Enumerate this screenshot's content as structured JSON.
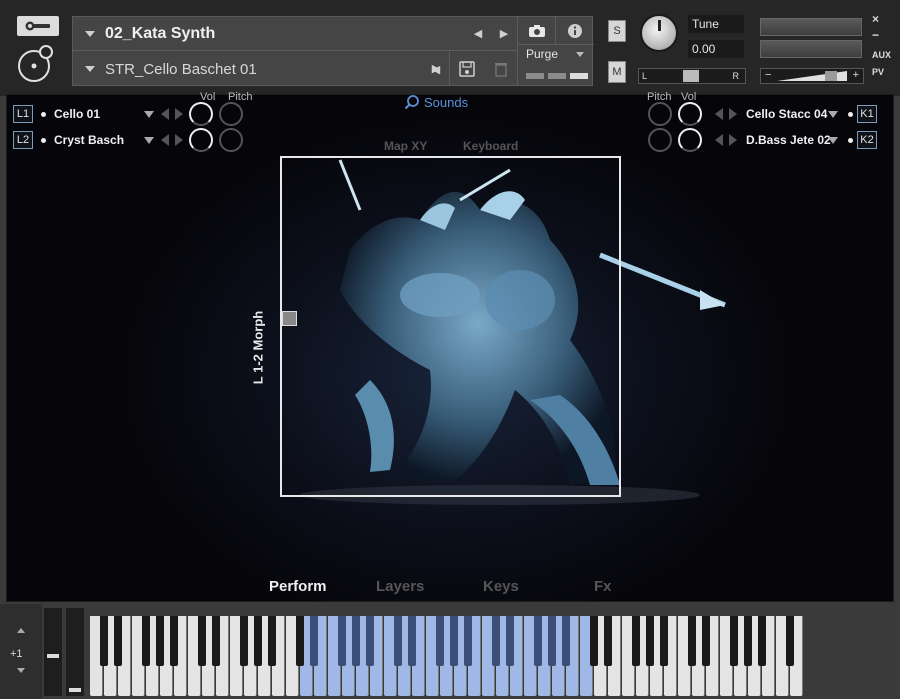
{
  "header": {
    "instrument_name": "02_Kata Synth",
    "preset_name": "STR_Cello Baschet 01",
    "purge_label": "Purge",
    "solo_label": "S",
    "mute_label": "M",
    "tune_label": "Tune",
    "tune_value": "0.00",
    "pan_left": "L",
    "pan_right": "R",
    "vol_minus": "−",
    "vol_plus": "+",
    "aux_label": "AUX",
    "pv_label": "PV",
    "close_symbol": "×",
    "minimize_symbol": "−"
  },
  "layers_left": [
    {
      "badge": "L1",
      "name": "Cello 01"
    },
    {
      "badge": "L2",
      "name": "Cryst Basch"
    }
  ],
  "layers_right": [
    {
      "badge": "K1",
      "name": "Cello Stacc 04"
    },
    {
      "badge": "K2",
      "name": "D.Bass Jete 02"
    }
  ],
  "knob_labels": {
    "vol": "Vol",
    "pitch": "Pitch"
  },
  "sounds_label": "Sounds",
  "view_tabs": {
    "map_xy": "Map XY",
    "keyboard": "Keyboard"
  },
  "morph_label": "L 1-2 Morph",
  "bottom_tabs": [
    "Perform",
    "Layers",
    "Keys",
    "Fx"
  ],
  "active_tab": "Perform",
  "keyboard": {
    "octave_value": "+1"
  },
  "colors": {
    "accent": "#5b8fd8",
    "key_highlight": "#9fb8e6",
    "background": "#07070c"
  }
}
